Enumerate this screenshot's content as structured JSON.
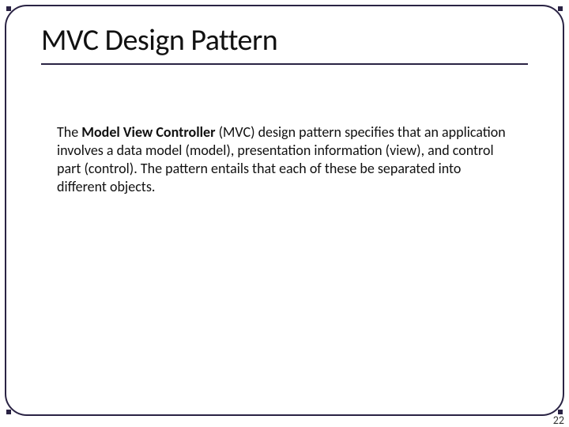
{
  "title": "MVC Design Pattern",
  "body": {
    "lead": "The ",
    "bold_term": "Model View Controller",
    "rest": " (MVC) design pattern specifies that an application involves a data model (model), presentation information (view), and control part (control). The pattern entails that each of these be separated into different objects."
  },
  "page_number": "22",
  "colors": {
    "frame": "#2a2344",
    "text": "#111111"
  }
}
